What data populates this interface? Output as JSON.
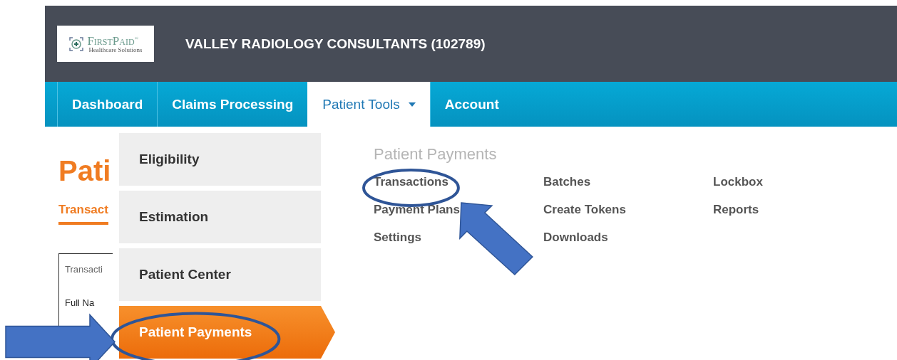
{
  "header": {
    "logo": {
      "name": "FirstPaid$^{®}$",
      "tagline": "Healthcare Solutions"
    },
    "title": "VALLEY RADIOLOGY CONSULTANTS (102789)"
  },
  "nav": {
    "tabs": [
      {
        "label": "Dashboard",
        "selected": false,
        "dropdown": false
      },
      {
        "label": "Claims Processing",
        "selected": false,
        "dropdown": false
      },
      {
        "label": "Patient Tools",
        "selected": true,
        "dropdown": true
      },
      {
        "label": "Account",
        "selected": false,
        "dropdown": false
      }
    ]
  },
  "page": {
    "heading": "Pati",
    "subtab": "Transact",
    "panel": {
      "title": "Transacti",
      "field_label": "Full Na"
    }
  },
  "menu": {
    "items": [
      {
        "label": "Eligibility",
        "selected": false,
        "annotated": false
      },
      {
        "label": "Estimation",
        "selected": false,
        "annotated": false
      },
      {
        "label": "Patient Center",
        "selected": false,
        "annotated": false
      },
      {
        "label": "Patient Payments",
        "selected": true,
        "annotated": true
      }
    ],
    "section": {
      "title": "Patient Payments",
      "columns": [
        [
          {
            "label": "Transactions",
            "annotated": true
          },
          {
            "label": "Payment Plans",
            "annotated": false
          },
          {
            "label": "Settings",
            "annotated": false
          }
        ],
        [
          {
            "label": "Batches",
            "annotated": false
          },
          {
            "label": "Create Tokens",
            "annotated": false
          },
          {
            "label": "Downloads",
            "annotated": false
          }
        ],
        [
          {
            "label": "Lockbox",
            "annotated": false
          },
          {
            "label": "Reports",
            "annotated": false
          }
        ]
      ]
    }
  }
}
